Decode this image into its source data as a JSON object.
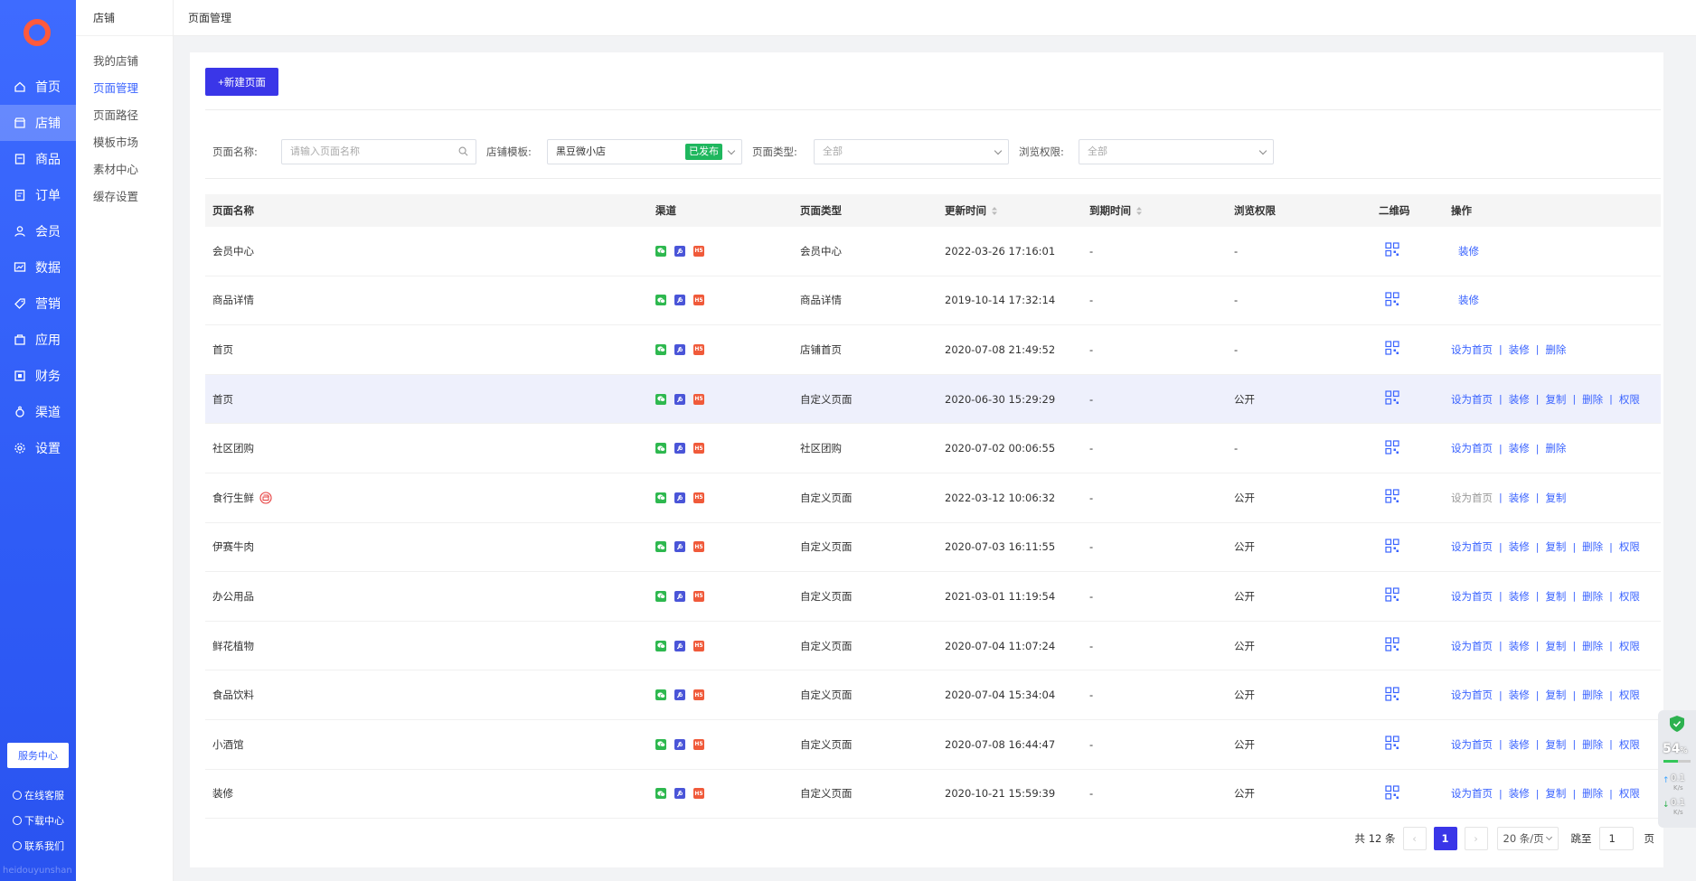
{
  "sidebar": {
    "items": [
      {
        "label": "首页",
        "icon": "home-icon"
      },
      {
        "label": "店铺",
        "icon": "store-icon",
        "active": true
      },
      {
        "label": "商品",
        "icon": "goods-icon"
      },
      {
        "label": "订单",
        "icon": "order-icon"
      },
      {
        "label": "会员",
        "icon": "member-icon"
      },
      {
        "label": "数据",
        "icon": "data-icon"
      },
      {
        "label": "营销",
        "icon": "tag-icon"
      },
      {
        "label": "应用",
        "icon": "app-icon"
      },
      {
        "label": "财务",
        "icon": "finance-icon"
      },
      {
        "label": "渠道",
        "icon": "channel-icon"
      },
      {
        "label": "设置",
        "icon": "gear-icon"
      }
    ],
    "service_center": "服务中心",
    "links": [
      "在线客服",
      "下载中心",
      "联系我们"
    ],
    "footer_text": "heidouyunshan"
  },
  "subnav": {
    "title": "店铺",
    "items": [
      "我的店铺",
      "页面管理",
      "页面路径",
      "模板市场",
      "素材中心",
      "缓存设置"
    ],
    "active_index": 1
  },
  "breadcrumb": "页面管理",
  "toolbar": {
    "new_page_label": "+新建页面"
  },
  "filters": {
    "page_name_label": "页面名称:",
    "page_name_placeholder": "请输入页面名称",
    "template_label": "店铺模板:",
    "template_value": "黑豆微小店",
    "template_status": "已发布",
    "page_type_label": "页面类型:",
    "page_type_value": "全部",
    "access_label": "浏览权限:",
    "access_value": "全部"
  },
  "table": {
    "headers": [
      "页面名称",
      "渠道",
      "页面类型",
      "更新时间",
      "到期时间",
      "浏览权限",
      "二维码",
      "操作"
    ],
    "rows": [
      {
        "name": "会员中心",
        "type": "会员中心",
        "updated": "2022-03-26 17:16:01",
        "expire": "-",
        "access": "-",
        "ops": [
          "装修"
        ],
        "single": true
      },
      {
        "name": "商品详情",
        "type": "商品详情",
        "updated": "2019-10-14 17:32:14",
        "expire": "-",
        "access": "-",
        "ops": [
          "装修"
        ],
        "single": true
      },
      {
        "name": "首页",
        "type": "店铺首页",
        "updated": "2020-07-08 21:49:52",
        "expire": "-",
        "access": "-",
        "ops": [
          "设为首页",
          "装修",
          "删除"
        ]
      },
      {
        "name": "首页",
        "type": "自定义页面",
        "updated": "2020-06-30 15:29:29",
        "expire": "-",
        "access": "公开",
        "ops": [
          "设为首页",
          "装修",
          "复制",
          "删除",
          "权限"
        ],
        "hover": true
      },
      {
        "name": "社区团购",
        "type": "社区团购",
        "updated": "2020-07-02 00:06:55",
        "expire": "-",
        "access": "-",
        "ops": [
          "设为首页",
          "装修",
          "删除"
        ]
      },
      {
        "name": "食行生鲜",
        "type": "自定义页面",
        "updated": "2022-03-12 10:06:32",
        "expire": "-",
        "access": "公开",
        "ops": [
          "设为首页",
          "装修",
          "复制"
        ],
        "first_disabled": true,
        "shop_badge": true
      },
      {
        "name": "伊赛牛肉",
        "type": "自定义页面",
        "updated": "2020-07-03 16:11:55",
        "expire": "-",
        "access": "公开",
        "ops": [
          "设为首页",
          "装修",
          "复制",
          "删除",
          "权限"
        ]
      },
      {
        "name": "办公用品",
        "type": "自定义页面",
        "updated": "2021-03-01 11:19:54",
        "expire": "-",
        "access": "公开",
        "ops": [
          "设为首页",
          "装修",
          "复制",
          "删除",
          "权限"
        ]
      },
      {
        "name": "鲜花植物",
        "type": "自定义页面",
        "updated": "2020-07-04 11:07:24",
        "expire": "-",
        "access": "公开",
        "ops": [
          "设为首页",
          "装修",
          "复制",
          "删除",
          "权限"
        ]
      },
      {
        "name": "食品饮料",
        "type": "自定义页面",
        "updated": "2020-07-04 15:34:04",
        "expire": "-",
        "access": "公开",
        "ops": [
          "设为首页",
          "装修",
          "复制",
          "删除",
          "权限"
        ]
      },
      {
        "name": "小酒馆",
        "type": "自定义页面",
        "updated": "2020-07-08 16:44:47",
        "expire": "-",
        "access": "公开",
        "ops": [
          "设为首页",
          "装修",
          "复制",
          "删除",
          "权限"
        ]
      },
      {
        "name": "装修",
        "type": "自定义页面",
        "updated": "2020-10-21 15:59:39",
        "expire": "-",
        "access": "公开",
        "ops": [
          "设为首页",
          "装修",
          "复制",
          "删除",
          "权限"
        ]
      }
    ]
  },
  "pagination": {
    "total": "共 12 条",
    "current": "1",
    "page_size": "20 条/页",
    "goto_label": "跳至",
    "goto_value": "1",
    "unit": "页"
  },
  "widget": {
    "percent": "54",
    "percent_unit": "%",
    "up_speed": "0.1",
    "down_speed": "0.1",
    "speed_unit": "K/s"
  },
  "colors": {
    "primary": "#3a36e8",
    "link": "#3a63ff",
    "sidebar": "#2f5cf6",
    "published": "#1fb75e"
  }
}
